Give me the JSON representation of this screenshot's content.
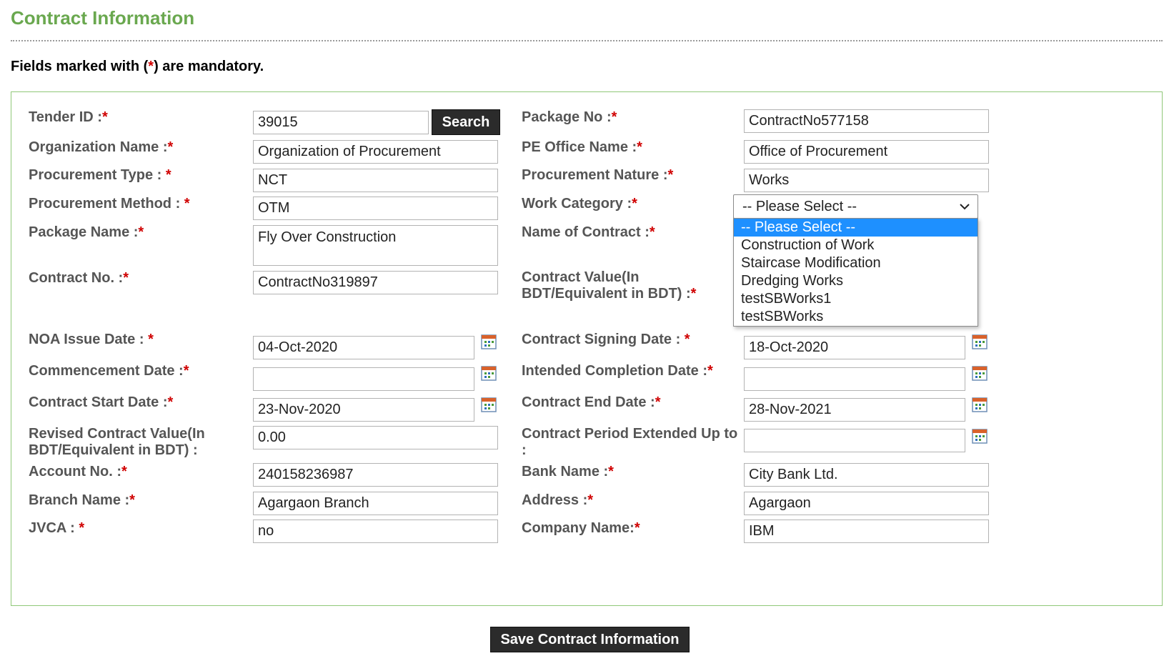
{
  "header": {
    "title": "Contract Information",
    "note_prefix": "Fields marked with (",
    "note_star": "*",
    "note_suffix": ") are mandatory."
  },
  "required_marker": "*",
  "left_fields": [
    {
      "label": "Tender ID :",
      "value": "39015"
    },
    {
      "label": "Organization Name :",
      "value": "Organization of Procurement"
    },
    {
      "label": "Procurement Type : ",
      "value": "NCT"
    },
    {
      "label": "Procurement Method : ",
      "value": "OTM"
    },
    {
      "label": "Package Name :",
      "value": "Fly Over Construction"
    },
    {
      "label": "Contract No. :",
      "value": "ContractNo319897"
    },
    {
      "label": "NOA Issue Date : ",
      "value": "04-Oct-2020"
    },
    {
      "label": "Commencement Date :",
      "value": ""
    },
    {
      "label": "Contract Start Date :",
      "value": "23-Nov-2020"
    },
    {
      "label_line1": "Revised Contract Value(In",
      "label_line2": "BDT/Equivalent in BDT) :",
      "value": "0.00"
    },
    {
      "label": "Account No. :",
      "value": "240158236987"
    },
    {
      "label": "Branch Name :",
      "value": "Agargaon Branch"
    },
    {
      "label": "JVCA : ",
      "value": "no"
    }
  ],
  "right_fields": [
    {
      "label": "Package No :",
      "value": "ContractNo577158"
    },
    {
      "label": "PE Office Name :",
      "value": "Office of Procurement"
    },
    {
      "label": "Procurement Nature :",
      "value": "Works"
    },
    {
      "label": "Work Category :"
    },
    {
      "label": "Name of Contract :"
    },
    {
      "label_line1": "Contract Value(In",
      "label_line2": "BDT/Equivalent in BDT) :"
    },
    {
      "label": "Contract Signing Date : ",
      "value": "18-Oct-2020"
    },
    {
      "label": "Intended Completion Date :",
      "value": ""
    },
    {
      "label": "Contract End Date :",
      "value": "28-Nov-2021"
    },
    {
      "label_line1": "Contract Period Extended Up to",
      "label_line2": ":",
      "value": ""
    },
    {
      "label": "Bank Name :",
      "value": "City Bank Ltd."
    },
    {
      "label": "Address :",
      "value": "Agargaon"
    },
    {
      "label": "Company Name:",
      "value": "IBM"
    }
  ],
  "search_button": "Search",
  "work_category": {
    "selected": "-- Please Select --",
    "options": [
      "-- Please Select --",
      "Construction of Work",
      "Staircase Modification",
      "Dredging Works",
      "testSBWorks1",
      "testSBWorks"
    ]
  },
  "save_button": "Save Contract Information",
  "icons": {
    "calendar": "calendar-icon",
    "dropdown": "chevron-down-icon"
  },
  "colors": {
    "title": "#6aa84f",
    "required": "#d00000",
    "label": "#555555",
    "border": "#90c878",
    "selected_option": "#1e90ff",
    "button": "#2b2b2b"
  }
}
